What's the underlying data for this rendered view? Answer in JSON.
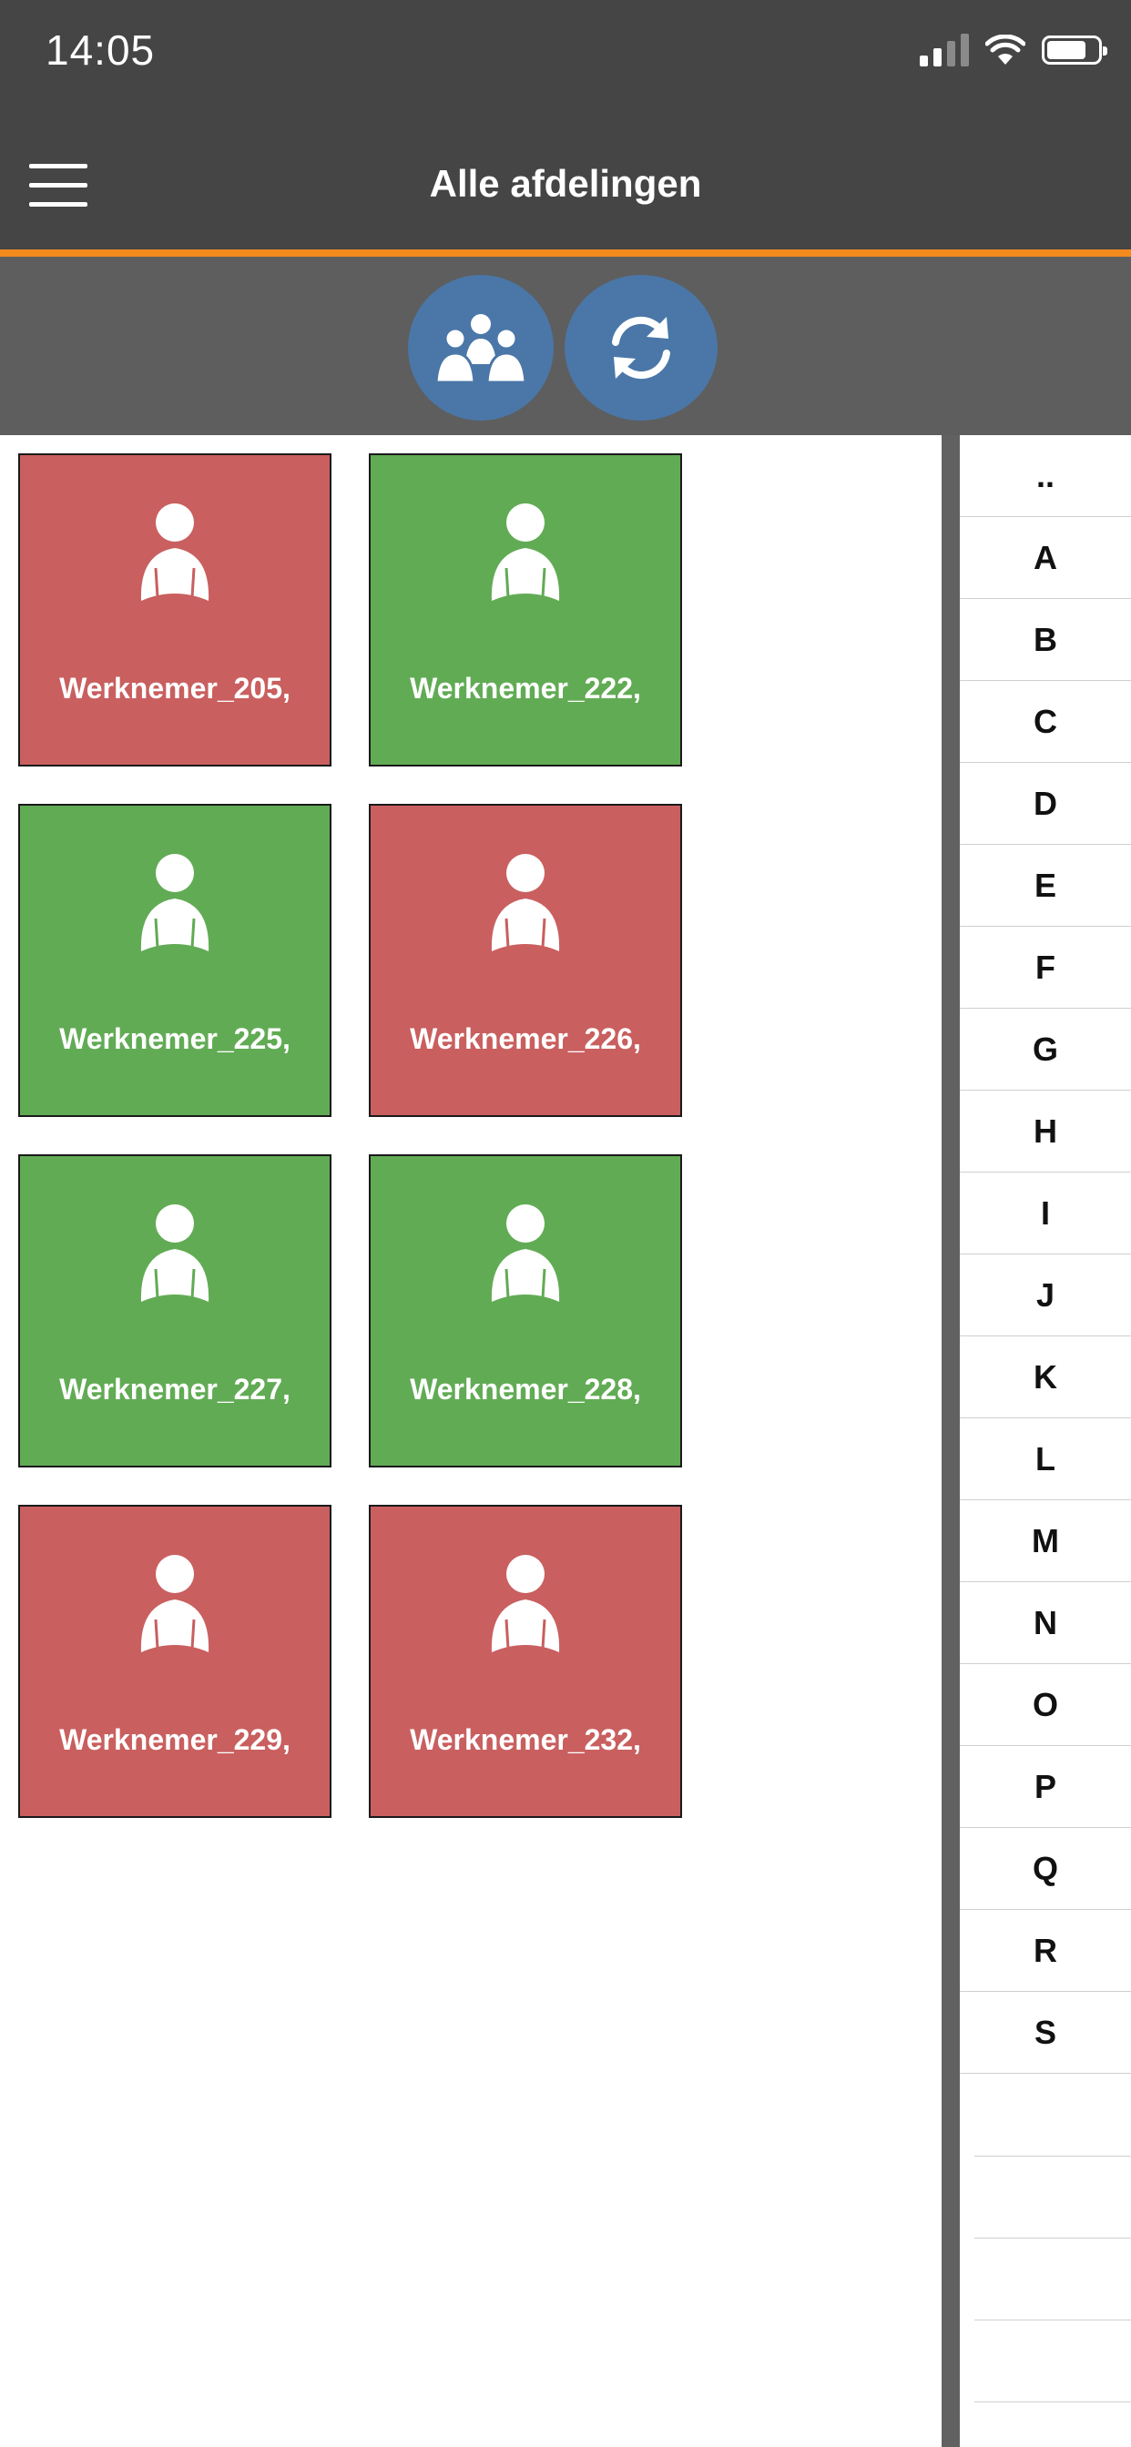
{
  "status_bar": {
    "time": "14:05",
    "icons": [
      "signal-icon",
      "wifi-icon",
      "battery-icon"
    ]
  },
  "header": {
    "title": "Alle afdelingen",
    "menu_icon": "hamburger-menu-icon"
  },
  "toolbar": {
    "buttons": [
      {
        "icon": "group-icon"
      },
      {
        "icon": "refresh-icon"
      }
    ]
  },
  "colors": {
    "header_bg": "#454545",
    "accent_line": "#f28a1e",
    "toolbar_bg": "#5e5e5e",
    "button_blue": "#4a77a8",
    "tile_red": "#c95f5f",
    "tile_green": "#62ab55"
  },
  "employees": [
    {
      "label": "Werknemer_205,",
      "status": "red",
      "icon": "person-icon"
    },
    {
      "label": "Werknemer_222,",
      "status": "green",
      "icon": "person-icon"
    },
    {
      "label": "Werknemer_225,",
      "status": "green",
      "icon": "person-icon"
    },
    {
      "label": "Werknemer_226,",
      "status": "red",
      "icon": "person-icon"
    },
    {
      "label": "Werknemer_227,",
      "status": "green",
      "icon": "person-icon"
    },
    {
      "label": "Werknemer_228,",
      "status": "green",
      "icon": "person-icon"
    },
    {
      "label": "Werknemer_229,",
      "status": "red",
      "icon": "person-icon"
    },
    {
      "label": "Werknemer_232,",
      "status": "red",
      "icon": "person-icon"
    }
  ],
  "index": [
    "..",
    "A",
    "B",
    "C",
    "D",
    "E",
    "F",
    "G",
    "H",
    "I",
    "J",
    "K",
    "L",
    "M",
    "N",
    "O",
    "P",
    "Q",
    "R",
    "S"
  ]
}
